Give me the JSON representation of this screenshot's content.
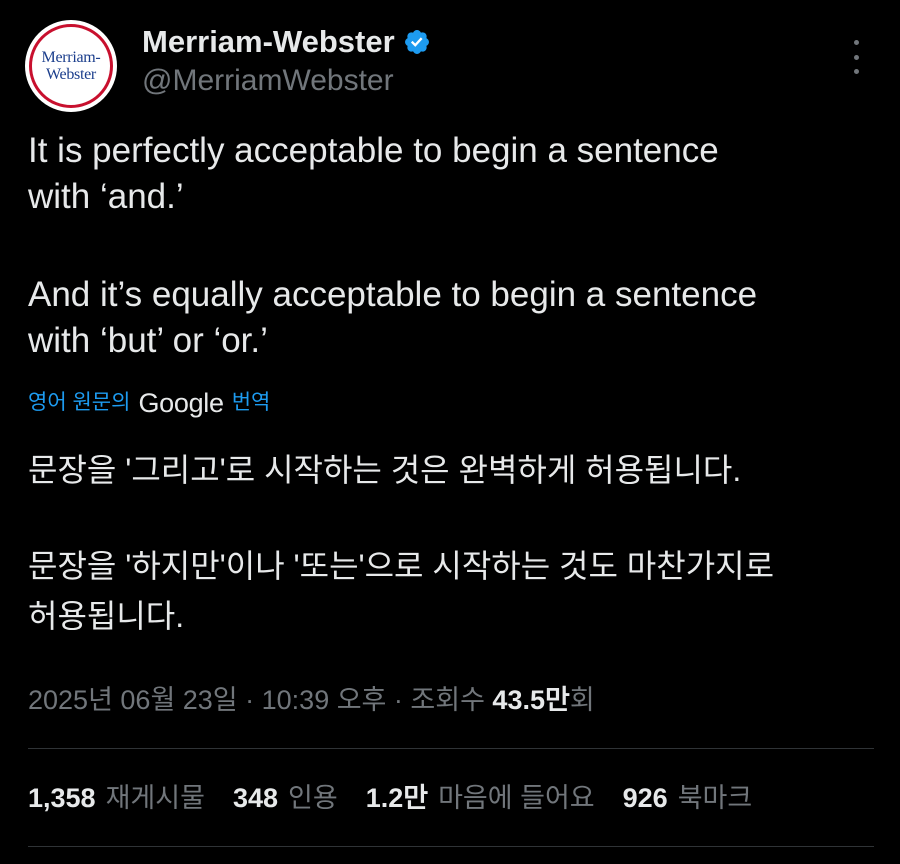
{
  "colors": {
    "background": "#000000",
    "text": "#e7e9ea",
    "secondary": "#71767b",
    "link": "#1d9bf0",
    "verified": "#1d9bf0",
    "divider": "#2f3336"
  },
  "author": {
    "avatar_text_line1": "Merriam-",
    "avatar_text_line2": "Webster",
    "display_name": "Merriam-Webster",
    "handle": "@MerriamWebster",
    "verified_icon": "verified-badge-icon"
  },
  "tweet": {
    "para1_line1": "It is perfectly acceptable to begin a sentence",
    "para1_line2": "with ‘and.’",
    "para2_line1": "And it’s equally acceptable to begin a sentence",
    "para2_line2": "with ‘but’ or ‘or.’"
  },
  "translation": {
    "prefix": "영어 원문의",
    "provider": "Google",
    "suffix": "번역",
    "para1_line1": "문장을 '그리고'로 시작하는 것은 완벽하게 허용됩니다.",
    "para2_line1": "문장을 '하지만'이나 '또는'으로 시작하는 것도 마찬가지로",
    "para2_line2": "허용됩니다."
  },
  "meta": {
    "timestamp": "2025년 06월 23일 · 10:39 오후 · 조회수 ",
    "views_count": "43.5만",
    "views_suffix": "회"
  },
  "stats": [
    {
      "value": "1,358",
      "label": "재게시물"
    },
    {
      "value": "348",
      "label": "인용"
    },
    {
      "value": "1.2만",
      "label": "마음에 들어요"
    },
    {
      "value": "926",
      "label": "북마크"
    }
  ]
}
